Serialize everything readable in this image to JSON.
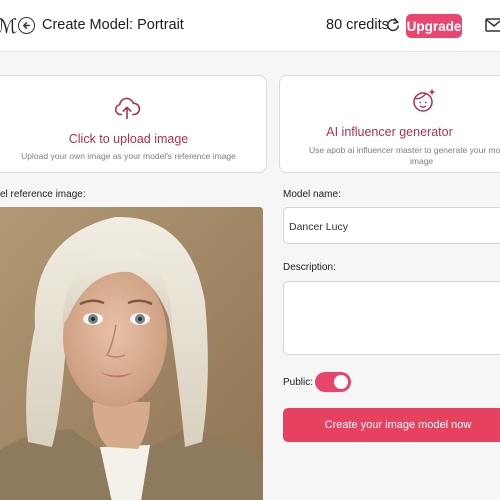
{
  "header": {
    "left_glyph": "ℳ",
    "title": "Create Model: Portrait",
    "credits": "80 credits",
    "upgrade_label": "Upgrade"
  },
  "cards": {
    "upload": {
      "title": "Click to upload image",
      "subtitle": "Upload your own image as your model's reference image"
    },
    "ai": {
      "title": "AI influencer generator",
      "subtitle_line1": "Use apob ai influencer master to generate your model's",
      "subtitle_line2": "image"
    }
  },
  "form": {
    "reference_label": "el reference image:",
    "name_label": "Model name:",
    "name_value": "Dancer Lucy",
    "description_label": "Description:",
    "description_value": "",
    "public_label": "Public:",
    "public_on": true,
    "create_label": "Create your image model now"
  },
  "colors": {
    "accent": "#ea4770",
    "card_title": "#b0304f",
    "create_button": "#e6425f"
  },
  "icons": {
    "back": "arrow-left-circle-icon",
    "refresh": "refresh-icon",
    "mail": "mail-icon",
    "upload": "cloud-upload-icon",
    "ai": "face-sparkle-icon"
  }
}
